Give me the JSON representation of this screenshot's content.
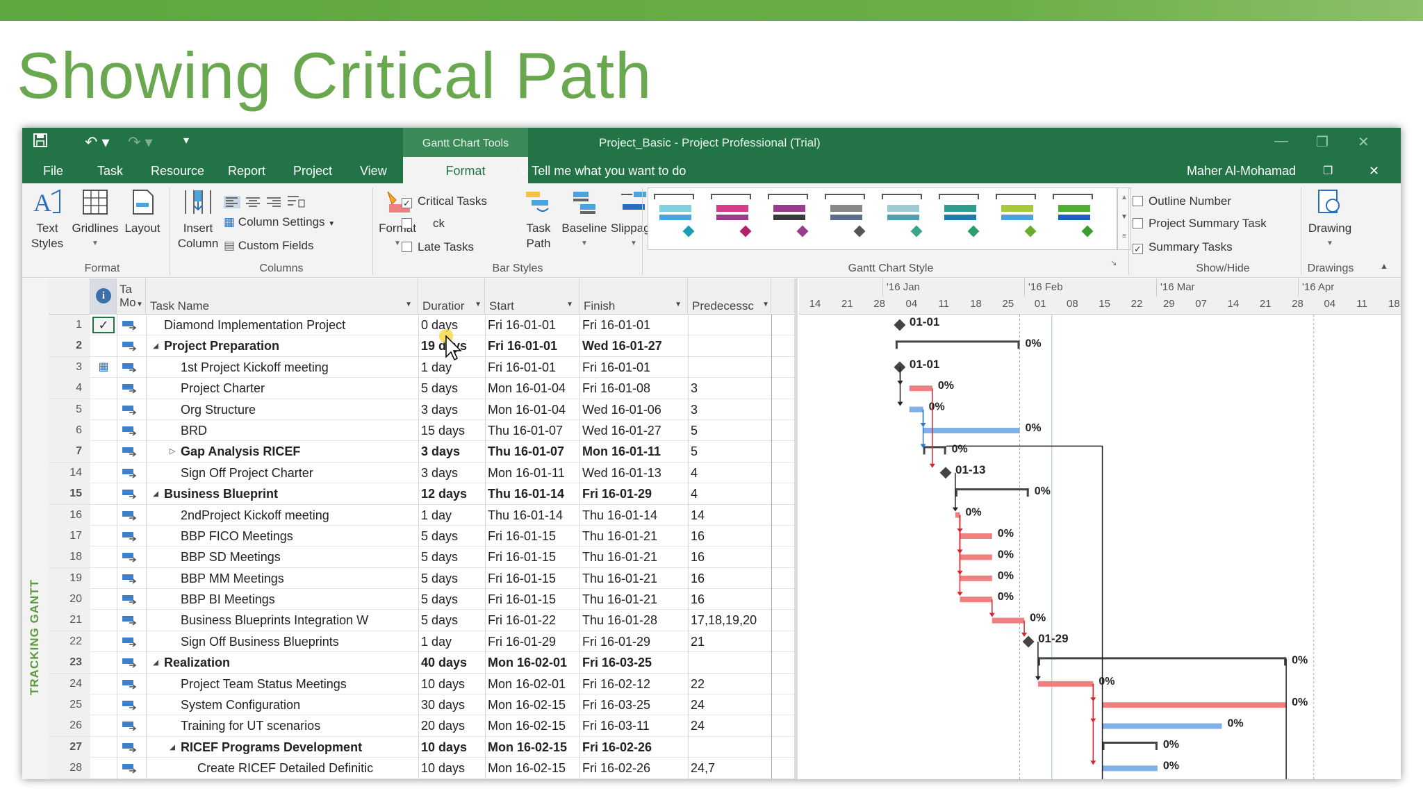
{
  "slide_title": "Showing Critical Path",
  "window": {
    "title": "Project_Basic - Project Professional (Trial)",
    "context_group": "Gantt Chart Tools",
    "user": "Maher Al-Mohamad",
    "tell_me": "Tell me what you want to do"
  },
  "tabs": [
    "File",
    "Task",
    "Resource",
    "Report",
    "Project",
    "View",
    "Format"
  ],
  "active_tab": "Format",
  "ribbon": {
    "format_group": {
      "text_styles": "Text Styles",
      "gridlines": "Gridlines",
      "layout": "Layout",
      "label": "Format"
    },
    "columns_group": {
      "insert_column": "Insert Column",
      "column_settings": "Column Settings",
      "custom_fields": "Custom Fields",
      "label": "Columns"
    },
    "bar_styles_group": {
      "format": "Format",
      "critical_tasks": "Critical Tasks",
      "slack": "ck",
      "late_tasks": "Late Tasks",
      "task_path": "Task Path",
      "baseline": "Baseline",
      "slippage": "Slippage",
      "label": "Bar Styles",
      "critical_tasks_checked": true,
      "slack_checked": false,
      "late_tasks_checked": false
    },
    "gantt_chart_style": {
      "label": "Gantt Chart Style",
      "swatches": [
        {
          "top": "#7ed0e0",
          "bottom": "#4aa3dc",
          "diamond": "#1b9fb7"
        },
        {
          "top": "#d63c8a",
          "bottom": "#9b3b8b",
          "diamond": "#b3206a"
        },
        {
          "top": "#9b3b8b",
          "bottom": "#3a3a3a",
          "diamond": "#9b3b8b"
        },
        {
          "top": "#888888",
          "bottom": "#5a6e8c",
          "diamond": "#555555"
        },
        {
          "top": "#9ecbd3",
          "bottom": "#4f9fb0",
          "diamond": "#3aa58b"
        },
        {
          "top": "#2f9e8f",
          "bottom": "#1f7aa8",
          "diamond": "#2f9e6f"
        },
        {
          "top": "#a6c83a",
          "bottom": "#4aa3dc",
          "diamond": "#6aae2e"
        },
        {
          "top": "#4fae2e",
          "bottom": "#1f5fbf",
          "diamond": "#3a9e2e"
        }
      ]
    },
    "show_hide": {
      "outline_number": "Outline Number",
      "project_summary_task": "Project Summary Task",
      "summary_tasks": "Summary Tasks",
      "label": "Show/Hide",
      "outline_checked": false,
      "project_summary_checked": false,
      "summary_checked": true
    },
    "drawings": {
      "drawing": "Drawing",
      "label": "Drawings"
    }
  },
  "sidebar_label": "TRACKING GANTT",
  "table": {
    "headers": {
      "mode": "Ta Mo",
      "name": "Task Name",
      "duration": "Duratior",
      "start": "Start",
      "finish": "Finish",
      "pred": "Predecessc"
    },
    "rows": [
      {
        "id": "1",
        "name": "Diamond Implementation Project",
        "indent": 0,
        "summary": false,
        "duration": "0 days",
        "start": "Fri 16-01-01",
        "finish": "Fri 16-01-01",
        "pred": "",
        "check": true
      },
      {
        "id": "2",
        "name": "Project Preparation",
        "indent": 0,
        "summary": true,
        "toggle": "down",
        "duration": "19 days",
        "start": "Fri 16-01-01",
        "finish": "Wed 16-01-27",
        "pred": ""
      },
      {
        "id": "3",
        "name": "1st Project Kickoff meeting",
        "indent": 1,
        "summary": false,
        "duration": "1 day",
        "start": "Fri 16-01-01",
        "finish": "Fri 16-01-01",
        "pred": "",
        "calendar": true
      },
      {
        "id": "4",
        "name": "Project Charter",
        "indent": 1,
        "summary": false,
        "duration": "5 days",
        "start": "Mon 16-01-04",
        "finish": "Fri 16-01-08",
        "pred": "3"
      },
      {
        "id": "5",
        "name": "Org Structure",
        "indent": 1,
        "summary": false,
        "duration": "3 days",
        "start": "Mon 16-01-04",
        "finish": "Wed 16-01-06",
        "pred": "3"
      },
      {
        "id": "6",
        "name": "BRD",
        "indent": 1,
        "summary": false,
        "duration": "15 days",
        "start": "Thu 16-01-07",
        "finish": "Wed 16-01-27",
        "pred": "5"
      },
      {
        "id": "7",
        "name": "Gap Analysis RICEF",
        "indent": 1,
        "summary": true,
        "toggle": "right",
        "duration": "3 days",
        "start": "Thu 16-01-07",
        "finish": "Mon 16-01-11",
        "pred": "5"
      },
      {
        "id": "14",
        "name": "Sign Off  Project Charter",
        "indent": 1,
        "summary": false,
        "duration": "3 days",
        "start": "Mon 16-01-11",
        "finish": "Wed 16-01-13",
        "pred": "4"
      },
      {
        "id": "15",
        "name": "Business Blueprint",
        "indent": 0,
        "summary": true,
        "toggle": "down",
        "duration": "12 days",
        "start": "Thu 16-01-14",
        "finish": "Fri 16-01-29",
        "pred": "4"
      },
      {
        "id": "16",
        "name": "2ndProject Kickoff meeting",
        "indent": 1,
        "summary": false,
        "duration": "1 day",
        "start": "Thu 16-01-14",
        "finish": "Thu 16-01-14",
        "pred": "14"
      },
      {
        "id": "17",
        "name": "BBP FICO Meetings",
        "indent": 1,
        "summary": false,
        "duration": "5 days",
        "start": "Fri 16-01-15",
        "finish": "Thu 16-01-21",
        "pred": "16"
      },
      {
        "id": "18",
        "name": "BBP SD Meetings",
        "indent": 1,
        "summary": false,
        "duration": "5 days",
        "start": "Fri 16-01-15",
        "finish": "Thu 16-01-21",
        "pred": "16"
      },
      {
        "id": "19",
        "name": "BBP MM Meetings",
        "indent": 1,
        "summary": false,
        "duration": "5 days",
        "start": "Fri 16-01-15",
        "finish": "Thu 16-01-21",
        "pred": "16"
      },
      {
        "id": "20",
        "name": "BBP BI Meetings",
        "indent": 1,
        "summary": false,
        "duration": "5 days",
        "start": "Fri 16-01-15",
        "finish": "Thu 16-01-21",
        "pred": "16"
      },
      {
        "id": "21",
        "name": "Business Blueprints Integration W",
        "indent": 1,
        "summary": false,
        "duration": "5 days",
        "start": "Fri 16-01-22",
        "finish": "Thu 16-01-28",
        "pred": "17,18,19,20"
      },
      {
        "id": "22",
        "name": "Sign Off  Business Blueprints",
        "indent": 1,
        "summary": false,
        "duration": "1 day",
        "start": "Fri 16-01-29",
        "finish": "Fri 16-01-29",
        "pred": "21"
      },
      {
        "id": "23",
        "name": "Realization",
        "indent": 0,
        "summary": true,
        "toggle": "down",
        "duration": "40 days",
        "start": "Mon 16-02-01",
        "finish": "Fri 16-03-25",
        "pred": ""
      },
      {
        "id": "24",
        "name": "Project Team Status Meetings",
        "indent": 1,
        "summary": false,
        "duration": "10 days",
        "start": "Mon 16-02-01",
        "finish": "Fri 16-02-12",
        "pred": "22"
      },
      {
        "id": "25",
        "name": "System Configuration",
        "indent": 1,
        "summary": false,
        "duration": "30 days",
        "start": "Mon 16-02-15",
        "finish": "Fri 16-03-25",
        "pred": "24"
      },
      {
        "id": "26",
        "name": "Training for UT scenarios",
        "indent": 1,
        "summary": false,
        "duration": "20 days",
        "start": "Mon 16-02-15",
        "finish": "Fri 16-03-11",
        "pred": "24"
      },
      {
        "id": "27",
        "name": "RICEF Programs Development",
        "indent": 1,
        "summary": true,
        "toggle": "down",
        "duration": "10 days",
        "start": "Mon 16-02-15",
        "finish": "Fri 16-02-26",
        "pred": ""
      },
      {
        "id": "28",
        "name": "Create RICEF Detailed Definitic",
        "indent": 2,
        "summary": false,
        "duration": "10 days",
        "start": "Mon 16-02-15",
        "finish": "Fri 16-02-26",
        "pred": "24,7"
      }
    ]
  },
  "timescale": {
    "months": [
      "'16 Jan",
      "'16 Feb",
      "'16 Mar",
      "'16 Apr"
    ],
    "days": [
      "14",
      "21",
      "28",
      "04",
      "11",
      "18",
      "25",
      "01",
      "08",
      "15",
      "22",
      "29",
      "07",
      "14",
      "21",
      "28",
      "04",
      "11",
      "18"
    ]
  },
  "gantt": {
    "colors": {
      "critical": "#f08080",
      "normal": "#7fb0e8",
      "summary": "#444444",
      "milestone": "#444444",
      "critical_link": "#d9232e",
      "normal_link": "#2a78c8"
    },
    "bars": [
      {
        "row": 0,
        "type": "milestone",
        "start": "2016-01-01",
        "label": "01-01"
      },
      {
        "row": 1,
        "type": "summary",
        "start": "2016-01-01",
        "end": "2016-01-27",
        "label": "0%"
      },
      {
        "row": 2,
        "type": "milestone",
        "start": "2016-01-01",
        "label": "01-01"
      },
      {
        "row": 3,
        "type": "critical",
        "start": "2016-01-04",
        "end": "2016-01-08",
        "label": "0%"
      },
      {
        "row": 4,
        "type": "normal",
        "start": "2016-01-04",
        "end": "2016-01-06",
        "label": "0%"
      },
      {
        "row": 5,
        "type": "normal",
        "start": "2016-01-07",
        "end": "2016-01-27",
        "label": "0%"
      },
      {
        "row": 6,
        "type": "summary",
        "start": "2016-01-07",
        "end": "2016-01-11",
        "label": "0%"
      },
      {
        "row": 7,
        "type": "milestone",
        "start": "2016-01-11",
        "label": "01-13"
      },
      {
        "row": 8,
        "type": "summary",
        "start": "2016-01-14",
        "end": "2016-01-29",
        "label": "0%"
      },
      {
        "row": 9,
        "type": "critical",
        "start": "2016-01-14",
        "end": "2016-01-14",
        "label": "0%"
      },
      {
        "row": 10,
        "type": "critical",
        "start": "2016-01-15",
        "end": "2016-01-21",
        "label": "0%"
      },
      {
        "row": 11,
        "type": "critical",
        "start": "2016-01-15",
        "end": "2016-01-21",
        "label": "0%"
      },
      {
        "row": 12,
        "type": "critical",
        "start": "2016-01-15",
        "end": "2016-01-21",
        "label": "0%"
      },
      {
        "row": 13,
        "type": "critical",
        "start": "2016-01-15",
        "end": "2016-01-21",
        "label": "0%"
      },
      {
        "row": 14,
        "type": "critical",
        "start": "2016-01-22",
        "end": "2016-01-28",
        "label": "0%"
      },
      {
        "row": 15,
        "type": "milestone",
        "start": "2016-01-29",
        "label": "01-29"
      },
      {
        "row": 16,
        "type": "summary",
        "start": "2016-02-01",
        "end": "2016-03-25",
        "label": "0%"
      },
      {
        "row": 17,
        "type": "critical",
        "start": "2016-02-01",
        "end": "2016-02-12",
        "label": "0%"
      },
      {
        "row": 18,
        "type": "critical",
        "start": "2016-02-15",
        "end": "2016-03-25",
        "label": "0%"
      },
      {
        "row": 19,
        "type": "normal",
        "start": "2016-02-15",
        "end": "2016-03-11",
        "label": "0%"
      },
      {
        "row": 20,
        "type": "summary",
        "start": "2016-02-15",
        "end": "2016-02-26",
        "label": "0%"
      },
      {
        "row": 21,
        "type": "normal",
        "start": "2016-02-15",
        "end": "2016-02-26",
        "label": "0%"
      }
    ]
  }
}
